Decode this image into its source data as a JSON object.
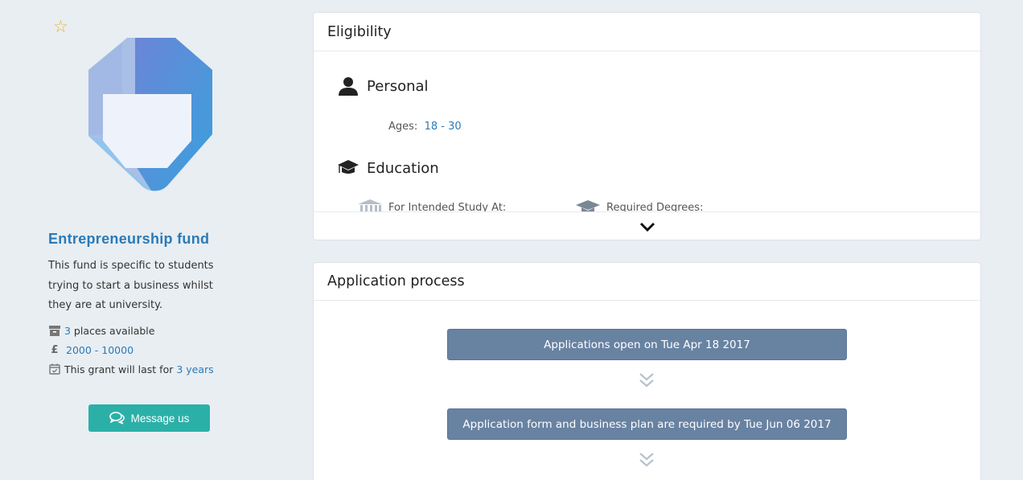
{
  "fund": {
    "title": "Entrepreneurship fund",
    "description": "This fund is specific to students trying to start a business whilst they are at university.",
    "places_count": "3",
    "places_label": " places available",
    "currency_symbol": "£",
    "amount_range": "2000 - 10000",
    "duration_prefix": "This grant will last for ",
    "duration_value": "3 years",
    "message_button": "Message us",
    "favorite_icon": "star-icon"
  },
  "eligibility": {
    "title": "Eligibility",
    "personal": {
      "heading": "Personal",
      "ages_label": "Ages: ",
      "ages_value": "18 - 30"
    },
    "education": {
      "heading": "Education",
      "study_label": "For Intended Study At:",
      "degrees_label": "Required Degrees:"
    }
  },
  "application": {
    "title": "Application process",
    "steps": [
      "Applications open on Tue Apr 18 2017",
      "Application form and business plan are required by Tue Jun 06 2017"
    ]
  },
  "colors": {
    "accent": "#2a7ab8",
    "button_teal": "#2bb0a8",
    "step_bg": "#6882a2",
    "star": "#e8b230"
  }
}
